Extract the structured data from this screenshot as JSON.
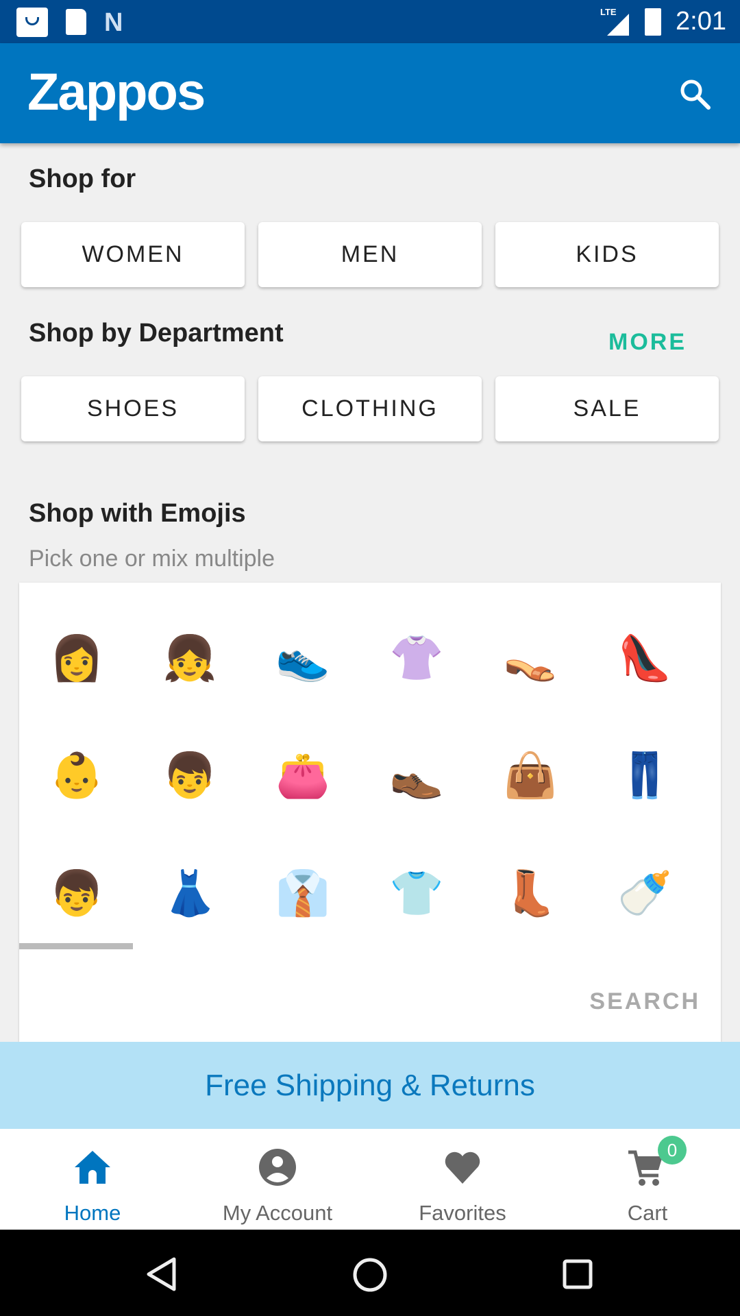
{
  "status_bar": {
    "time": "2:01",
    "network": "LTE"
  },
  "app_bar": {
    "logo": "Zappos",
    "search_icon": "search-icon"
  },
  "shop_for": {
    "title": "Shop for",
    "buttons": [
      "WOMEN",
      "MEN",
      "KIDS"
    ]
  },
  "department": {
    "title": "Shop by Department",
    "more": "MORE",
    "buttons": [
      "SHOES",
      "CLOTHING",
      "SALE"
    ]
  },
  "emojis": {
    "title": "Shop with Emojis",
    "subtitle": "Pick one or mix multiple",
    "items": [
      "👩",
      "👧",
      "👟",
      "👚",
      "👡",
      "👠",
      "👶",
      "👦",
      "👛",
      "👞",
      "👜",
      "👖",
      "👦",
      "👗",
      "👔",
      "👕",
      "👢",
      "🍼"
    ],
    "search": "SEARCH"
  },
  "banner": {
    "text": "Free Shipping & Returns"
  },
  "bottom_nav": {
    "items": [
      {
        "label": "Home",
        "active": true
      },
      {
        "label": "My Account"
      },
      {
        "label": "Favorites"
      },
      {
        "label": "Cart",
        "badge": "0"
      }
    ]
  },
  "colors": {
    "brand": "#0075bf",
    "accent": "#1bbc9b",
    "badge": "#4cc98f"
  }
}
